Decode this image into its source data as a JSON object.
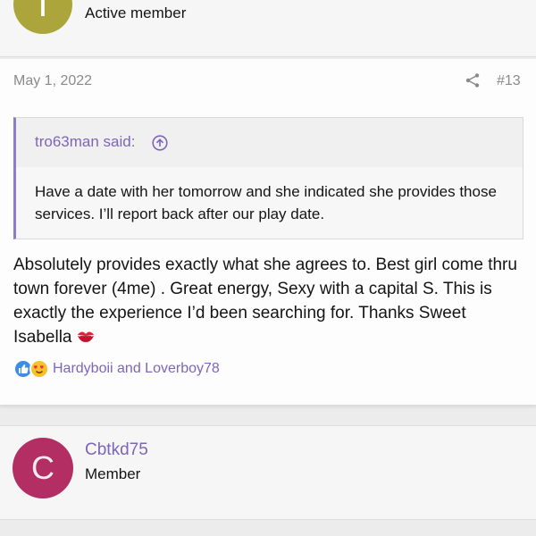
{
  "top_user": {
    "role": "Active member",
    "avatar_letter": "T"
  },
  "post": {
    "date": "May 1, 2022",
    "number": "#13",
    "quote": {
      "author_label": "tro63man said:",
      "text": "Have a date with her tomorrow and she indicated she provides those services. I’ll report back after our play date."
    },
    "body": "Absolutely provides exactly what she agrees to. Best girl come thru town forever (4me) . Great energy, Sexy with a capital S. This is exactly the experience I’d been searching for. Thanks Sweet Isabella",
    "body_icon": "kiss-mark-icon",
    "reactions": {
      "users_text": "Hardyboii and Loverboy78",
      "icons": [
        "like-icon",
        "love-icon"
      ]
    }
  },
  "second_user": {
    "name": "Cbtkd75",
    "role": "Member",
    "avatar_letters": "C"
  },
  "colors": {
    "accent": "#7d66b8",
    "quote_border": "#8f7bc9",
    "avatar_top": "#aba53c",
    "avatar_second": "#b22e63"
  }
}
